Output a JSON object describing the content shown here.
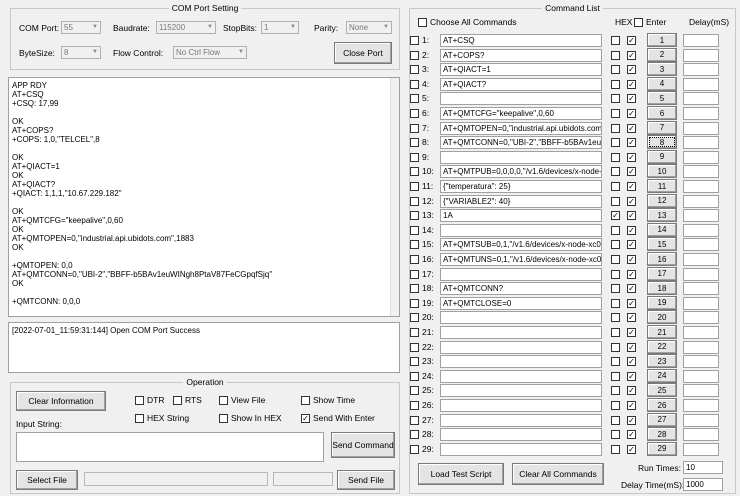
{
  "port_settings": {
    "title": "COM Port Setting",
    "com_port_label": "COM Port:",
    "com_port": "55",
    "baudrate_label": "Baudrate:",
    "baudrate": "115200",
    "stopbits_label": "StopBits:",
    "stopbits": "1",
    "parity_label": "Parity:",
    "parity": "None",
    "bytesize_label": "ByteSize:",
    "bytesize": "8",
    "flow_label": "Flow Control:",
    "flow": "No Ctrl Flow",
    "close_port": "Close Port"
  },
  "receive_log": "APP RDY\nAT+CSQ\n+CSQ: 17,99\n\nOK\nAT+COPS?\n+COPS: 1,0,\"TELCEL\",8\n\nOK\nAT+QIACT=1\nOK\nAT+QIACT?\n+QIACT: 1,1,1,\"10.67.229.182\"\n\nOK\nAT+QMTCFG=\"keepalive\",0,60\nOK\nAT+QMTOPEN=0,\"industrial.api.ubidots.com\",1883\nOK\n\n+QMTOPEN: 0,0\nAT+QMTCONN=0,\"UBI-2\",\"BBFF-b5BAv1euWINgh8PtaV87FeCGpqfSjq\"\nOK\n\n+QMTCONN: 0,0,0",
  "status_log": "[2022-07-01_11:59:31:144] Open COM Port Success",
  "operation": {
    "title": "Operation",
    "clear_information": "Clear Information",
    "dtr": "DTR",
    "rts": "RTS",
    "view_file": "View File",
    "show_time": "Show Time",
    "hex_string": "HEX String",
    "show_in_hex": "Show In HEX",
    "send_with_enter": "Send With Enter",
    "input_string_label": "Input String:",
    "send_command": "Send Command",
    "select_file": "Select File",
    "send_file": "Send File"
  },
  "command_list": {
    "title": "Command List",
    "choose_all": "Choose All Commands",
    "hex_header": "HEX",
    "enter_header": "Enter",
    "delay_header": "Delay(mS)",
    "load_test_script": "Load Test Script",
    "clear_all_commands": "Clear All Commands",
    "run_times_label": "Run Times:",
    "run_times": "10",
    "delay_time_label": "Delay Time(mS):",
    "delay_time": "1000",
    "rows": [
      {
        "num": "1:",
        "cmd": "AT+CSQ",
        "hex": false,
        "enter": true
      },
      {
        "num": "2:",
        "cmd": "AT+COPS?",
        "hex": false,
        "enter": true
      },
      {
        "num": "3:",
        "cmd": "AT+QIACT=1",
        "hex": false,
        "enter": true
      },
      {
        "num": "4:",
        "cmd": "AT+QIACT?",
        "hex": false,
        "enter": true
      },
      {
        "num": "5:",
        "cmd": "",
        "hex": false,
        "enter": true
      },
      {
        "num": "6:",
        "cmd": "AT+QMTCFG=\"keepalive\",0,60",
        "hex": false,
        "enter": true
      },
      {
        "num": "7:",
        "cmd": "AT+QMTOPEN=0,\"industrial.api.ubidots.com",
        "hex": false,
        "enter": true
      },
      {
        "num": "8:",
        "cmd": "AT+QMTCONN=0,\"UBI-2\",\"BBFF-b5BAv1euV",
        "hex": false,
        "enter": true
      },
      {
        "num": "9:",
        "cmd": "",
        "hex": false,
        "enter": true
      },
      {
        "num": "10:",
        "cmd": "AT+QMTPUB=0,0,0,0,\"/v1.6/devices/x-node-",
        "hex": false,
        "enter": true
      },
      {
        "num": "11:",
        "cmd": "{\"temperatura\": 25}",
        "hex": false,
        "enter": true
      },
      {
        "num": "12:",
        "cmd": "{\"VARIABLE2\": 40}",
        "hex": false,
        "enter": true
      },
      {
        "num": "13:",
        "cmd": "1A",
        "hex": true,
        "enter": true
      },
      {
        "num": "14:",
        "cmd": "",
        "hex": false,
        "enter": true
      },
      {
        "num": "15:",
        "cmd": "AT+QMTSUB=0,1,\"/v1.6/devices/x-node-xc0",
        "hex": false,
        "enter": true
      },
      {
        "num": "16:",
        "cmd": "AT+QMTUNS=0,1,\"/v1.6/devices/x-node-xc0",
        "hex": false,
        "enter": true
      },
      {
        "num": "17:",
        "cmd": "",
        "hex": false,
        "enter": true
      },
      {
        "num": "18:",
        "cmd": "AT+QMTCONN?",
        "hex": false,
        "enter": true
      },
      {
        "num": "19:",
        "cmd": "AT+QMTCLOSE=0",
        "hex": false,
        "enter": true
      },
      {
        "num": "20:",
        "cmd": "",
        "hex": false,
        "enter": true
      },
      {
        "num": "21:",
        "cmd": "",
        "hex": false,
        "enter": true
      },
      {
        "num": "22:",
        "cmd": "",
        "hex": false,
        "enter": true
      },
      {
        "num": "23:",
        "cmd": "",
        "hex": false,
        "enter": true
      },
      {
        "num": "24:",
        "cmd": "",
        "hex": false,
        "enter": true
      },
      {
        "num": "25:",
        "cmd": "",
        "hex": false,
        "enter": true
      },
      {
        "num": "26:",
        "cmd": "",
        "hex": false,
        "enter": true
      },
      {
        "num": "27:",
        "cmd": "",
        "hex": false,
        "enter": true
      },
      {
        "num": "28:",
        "cmd": "",
        "hex": false,
        "enter": true
      },
      {
        "num": "29:",
        "cmd": "",
        "hex": false,
        "enter": true
      }
    ],
    "send_buttons": [
      "1",
      "2",
      "3",
      "4",
      "5",
      "6",
      "7",
      "8",
      "9",
      "10",
      "11",
      "12",
      "13",
      "14",
      "15",
      "16",
      "17",
      "18",
      "19",
      "20",
      "21",
      "22",
      "23",
      "24",
      "25",
      "26",
      "27",
      "28",
      "29"
    ]
  }
}
